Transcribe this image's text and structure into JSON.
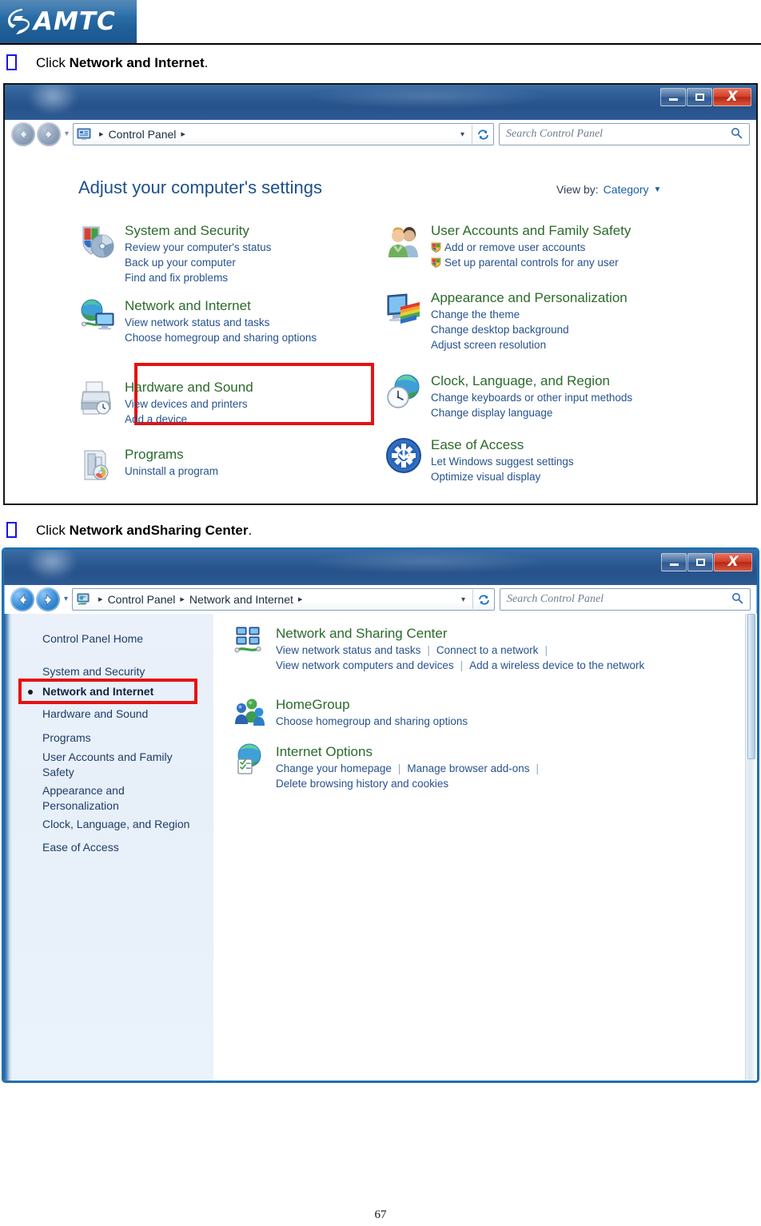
{
  "header": {
    "logo_text": "AMTC",
    "logo_icon": "swoosh-icon",
    "logo_bg": "#2a6ea8"
  },
  "steps": [
    {
      "prefix": "Click ",
      "bold": "Network and Internet",
      "suffix": "."
    },
    {
      "prefix": "Click ",
      "bold": "Network andSharing Center",
      "suffix": "."
    }
  ],
  "window1": {
    "titlebar": {
      "minimize_label": "–",
      "maximize_label": "□",
      "close_label": "X"
    },
    "nav": {
      "back_icon": "arrow-left-icon",
      "forward_icon": "arrow-right-icon",
      "history_icon": "chevron-down-icon"
    },
    "address": {
      "icon": "control-panel-icon",
      "crumbs": [
        "Control Panel"
      ],
      "dropdown_icon": "chevron-down-icon",
      "refresh_icon": "refresh-icon"
    },
    "search": {
      "placeholder": "Search Control Panel",
      "icon": "search-icon"
    },
    "heading": "Adjust your computer's settings",
    "view_by": {
      "label": "View by:",
      "value": "Category",
      "caret": "▼"
    },
    "categories_left": [
      {
        "icon": "shield-security-icon",
        "title": "System and Security",
        "links": [
          "Review your computer's status",
          "Back up your computer",
          "Find and fix problems"
        ]
      },
      {
        "icon": "network-globe-icon",
        "title": "Network and Internet",
        "links": [
          "View network status and tasks",
          "Choose homegroup and sharing options"
        ],
        "highlighted": true
      },
      {
        "icon": "printer-icon",
        "title": "Hardware and Sound",
        "links": [
          "View devices and printers",
          "Add a device"
        ]
      },
      {
        "icon": "programs-icon",
        "title": "Programs",
        "links": [
          "Uninstall a program"
        ]
      }
    ],
    "categories_right": [
      {
        "icon": "users-icon",
        "title": "User Accounts and Family Safety",
        "links": [
          "Add or remove user accounts",
          "Set up parental controls for any user"
        ],
        "link_shields": [
          true,
          true
        ]
      },
      {
        "icon": "appearance-icon",
        "title": "Appearance and Personalization",
        "links": [
          "Change the theme",
          "Change desktop background",
          "Adjust screen resolution"
        ]
      },
      {
        "icon": "clock-globe-icon",
        "title": "Clock, Language, and Region",
        "links": [
          "Change keyboards or other input methods",
          "Change display language"
        ]
      },
      {
        "icon": "ease-of-access-icon",
        "title": "Ease of Access",
        "links": [
          "Let Windows suggest settings",
          "Optimize visual display"
        ]
      }
    ]
  },
  "window2": {
    "titlebar": {
      "minimize_label": "–",
      "maximize_label": "□",
      "close_label": "X"
    },
    "address": {
      "icon": "network-panel-icon",
      "crumbs": [
        "Control Panel",
        "Network and Internet"
      ]
    },
    "search": {
      "placeholder": "Search Control Panel",
      "icon": "search-icon"
    },
    "sidebar": [
      {
        "label": "Control Panel Home",
        "selected": false
      },
      {
        "label": "System and Security",
        "selected": false
      },
      {
        "label": "Network and Internet",
        "selected": true
      },
      {
        "label": "Hardware and Sound",
        "selected": false
      },
      {
        "label": "Programs",
        "selected": false
      },
      {
        "label": "User Accounts and Family Safety",
        "selected": false
      },
      {
        "label": "Appearance and Personalization",
        "selected": false
      },
      {
        "label": "Clock, Language, and Region",
        "selected": false
      },
      {
        "label": "Ease of Access",
        "selected": false
      }
    ],
    "items": [
      {
        "icon": "network-sharing-icon",
        "title": "Network and Sharing Center",
        "row1": [
          "View network status and tasks",
          "Connect to a network"
        ],
        "row1_trailing_pipe": true,
        "row2": [
          "View network computers and devices",
          "Add a wireless device to the network"
        ]
      },
      {
        "icon": "homegroup-icon",
        "title": "HomeGroup",
        "row1": [
          "Choose homegroup and sharing options"
        ],
        "row1_trailing_pipe": false,
        "row2": []
      },
      {
        "icon": "internet-options-icon",
        "title": "Internet Options",
        "row1": [
          "Change your homepage",
          "Manage browser add-ons"
        ],
        "row1_trailing_pipe": true,
        "row2": [
          "Delete browsing history and cookies"
        ]
      }
    ]
  },
  "footer": {
    "page_number": "67"
  },
  "colors": {
    "highlight_red": "#e61212",
    "category_green": "#2b6a2b",
    "link_blue": "#27528d",
    "heading_blue": "#1d4f8c",
    "brand_blue": "#2a6ea8"
  }
}
